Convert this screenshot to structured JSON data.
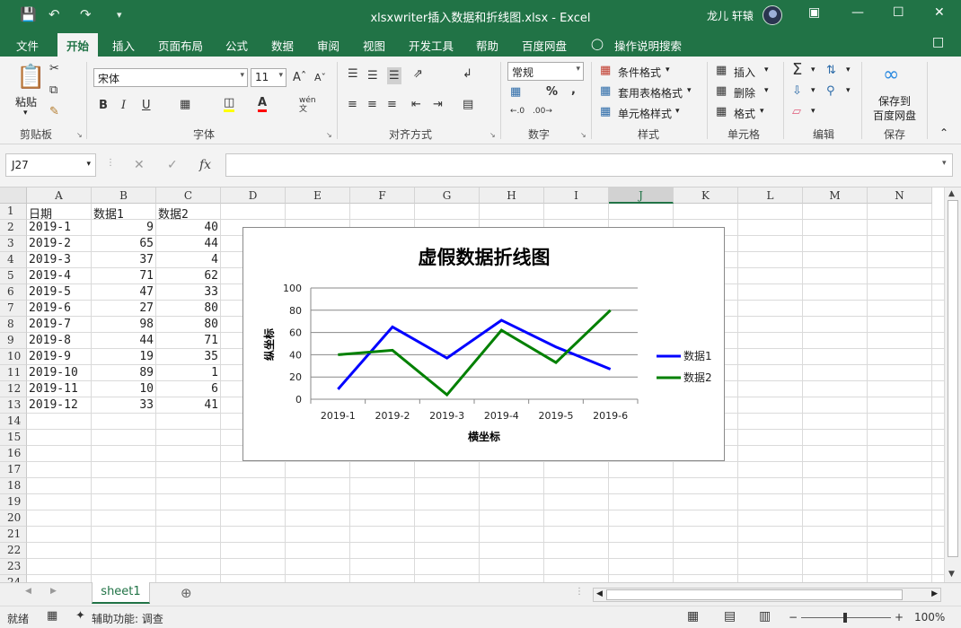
{
  "window": {
    "title": "xlsxwriter插入数据和折线图.xlsx  -  Excel",
    "user": "龙儿 轩辕"
  },
  "ribbon_tabs": [
    "文件",
    "开始",
    "插入",
    "页面布局",
    "公式",
    "数据",
    "审阅",
    "视图",
    "开发工具",
    "帮助",
    "百度网盘",
    "操作说明搜索"
  ],
  "ribbon": {
    "clipboard": {
      "paste": "粘贴",
      "label": "剪贴板"
    },
    "font": {
      "name": "宋体",
      "size": "11",
      "label": "字体"
    },
    "alignment": {
      "label": "对齐方式"
    },
    "number": {
      "format": "常规",
      "label": "数字"
    },
    "styles": {
      "conditional": "条件格式",
      "table": "套用表格格式",
      "cell": "单元格样式",
      "label": "样式"
    },
    "cells": {
      "insert": "插入",
      "delete": "删除",
      "format": "格式",
      "label": "单元格"
    },
    "editing": {
      "label": "编辑"
    },
    "save": {
      "line1": "保存到",
      "line2": "百度网盘",
      "label": "保存"
    }
  },
  "formula_bar": {
    "name_box": "J27",
    "fx": "fx",
    "value": ""
  },
  "columns": [
    "A",
    "B",
    "C",
    "D",
    "E",
    "F",
    "G",
    "H",
    "I",
    "J",
    "K",
    "L",
    "M",
    "N"
  ],
  "selected_column": "J",
  "rows": [
    "1",
    "2",
    "3",
    "4",
    "5",
    "6",
    "7",
    "8",
    "9",
    "10",
    "11",
    "12",
    "13",
    "14",
    "15",
    "16",
    "17",
    "18",
    "19",
    "20",
    "21",
    "22",
    "23",
    "24"
  ],
  "headers": [
    "日期",
    "数据1",
    "数据2"
  ],
  "table": [
    [
      "2019-1",
      "9",
      "40"
    ],
    [
      "2019-2",
      "65",
      "44"
    ],
    [
      "2019-3",
      "37",
      "4"
    ],
    [
      "2019-4",
      "71",
      "62"
    ],
    [
      "2019-5",
      "47",
      "33"
    ],
    [
      "2019-6",
      "27",
      "80"
    ],
    [
      "2019-7",
      "98",
      "80"
    ],
    [
      "2019-8",
      "44",
      "71"
    ],
    [
      "2019-9",
      "19",
      "35"
    ],
    [
      "2019-10",
      "89",
      "1"
    ],
    [
      "2019-11",
      "10",
      "6"
    ],
    [
      "2019-12",
      "33",
      "41"
    ]
  ],
  "chart_data": {
    "type": "line",
    "title": "虚假数据折线图",
    "xlabel": "横坐标",
    "ylabel": "纵坐标",
    "categories": [
      "2019-1",
      "2019-2",
      "2019-3",
      "2019-4",
      "2019-5",
      "2019-6"
    ],
    "series": [
      {
        "name": "数据1",
        "values": [
          9,
          65,
          37,
          71,
          47,
          27
        ],
        "color": "#0000ff"
      },
      {
        "name": "数据2",
        "values": [
          40,
          44,
          4,
          62,
          33,
          80
        ],
        "color": "#008000"
      }
    ],
    "ylim": [
      0,
      100
    ],
    "yticks": [
      "0",
      "20",
      "40",
      "60",
      "80",
      "100"
    ],
    "grid": true,
    "legend": "right"
  },
  "sheet": {
    "name": "sheet1"
  },
  "status": {
    "ready": "就绪",
    "accessibility": "辅助功能: 调查",
    "zoom": "100%"
  }
}
